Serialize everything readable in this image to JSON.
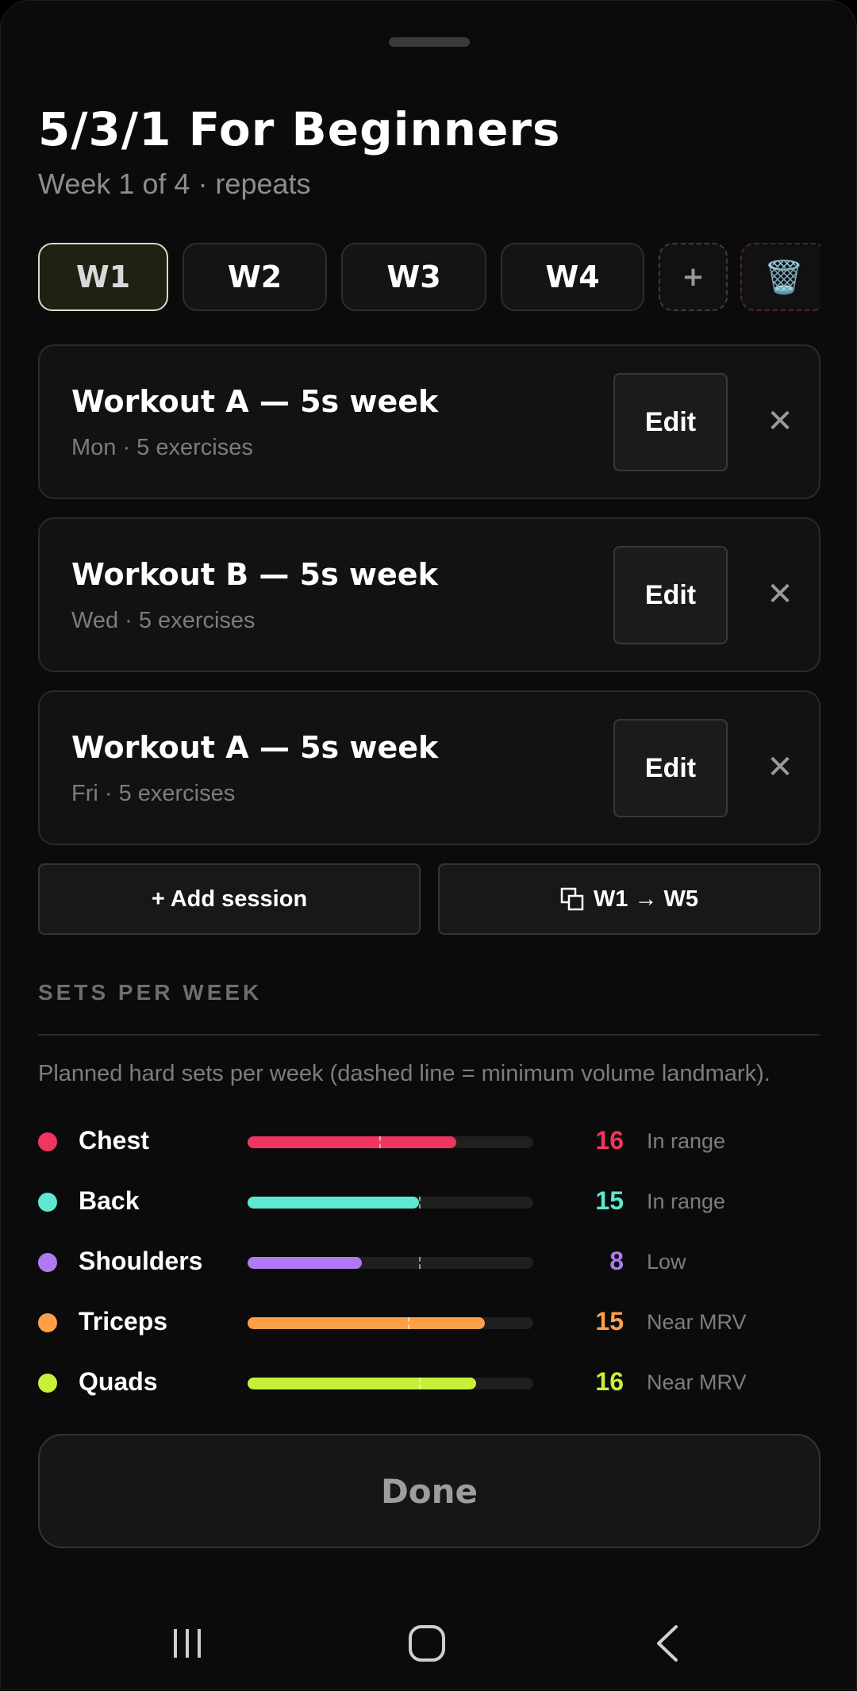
{
  "header": {
    "title": "5/3/1 For Beginners",
    "subtitle": "Week 1 of 4 · repeats"
  },
  "week_tabs": [
    {
      "label": "W1",
      "active": true
    },
    {
      "label": "W2",
      "active": false
    },
    {
      "label": "W3",
      "active": false
    },
    {
      "label": "W4",
      "active": false
    }
  ],
  "add_week_label": "+",
  "delete_week_icon": "🗑️",
  "sessions": [
    {
      "name": "Workout A — 5s week",
      "meta": "Mon · 5 exercises",
      "edit_label": "Edit",
      "remove_label": "✕"
    },
    {
      "name": "Workout B — 5s week",
      "meta": "Wed · 5 exercises",
      "edit_label": "Edit",
      "remove_label": "✕"
    },
    {
      "name": "Workout A — 5s week",
      "meta": "Fri · 5 exercises",
      "edit_label": "Edit",
      "remove_label": "✕"
    }
  ],
  "actions": {
    "add_session_label": "+ Add session",
    "copy_week_label": "W1 → W5",
    "copy_week_icon": "copy-icon"
  },
  "volume": {
    "section_label": "SETS PER WEEK",
    "description": "Planned hard sets per week (dashed line = minimum volume landmark).",
    "muscles": [
      {
        "name": "Chest",
        "sets": "16",
        "status": "In range",
        "color": "#f0355f",
        "fill_fraction": 0.73,
        "landmark_fraction": 0.46
      },
      {
        "name": "Back",
        "sets": "15",
        "status": "In range",
        "color": "#5ee8cf",
        "fill_fraction": 0.6,
        "landmark_fraction": 0.6
      },
      {
        "name": "Shoulders",
        "sets": "8",
        "status": "Low",
        "color": "#b07af5",
        "fill_fraction": 0.4,
        "landmark_fraction": 0.6
      },
      {
        "name": "Triceps",
        "sets": "15",
        "status": "Near MRV",
        "color": "#ff9f48",
        "fill_fraction": 0.83,
        "landmark_fraction": 0.56
      },
      {
        "name": "Quads",
        "sets": "16",
        "status": "Near MRV",
        "color": "#c8f03a",
        "fill_fraction": 0.8,
        "landmark_fraction": 0.6
      }
    ]
  },
  "done_label": "Done",
  "system_nav": {
    "recents_icon": "recents-icon",
    "home_icon": "home-icon",
    "back_icon": "back-icon"
  }
}
